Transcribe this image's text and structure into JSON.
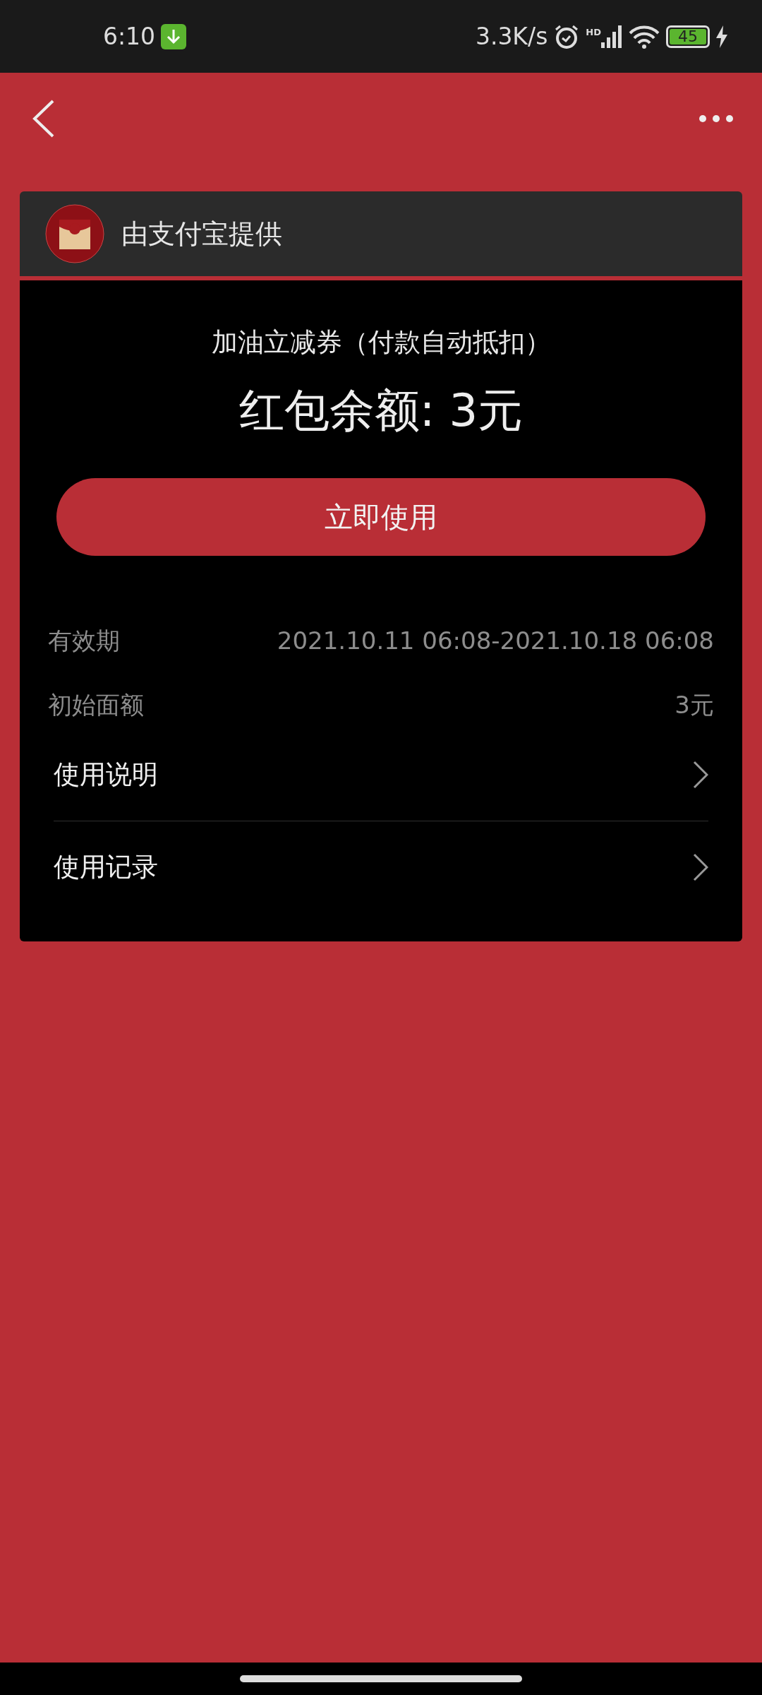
{
  "status_bar": {
    "time": "6:10",
    "speed": "3.3K/s",
    "network_badge": "HD",
    "battery": "45"
  },
  "provider": {
    "text": "由支付宝提供"
  },
  "voucher": {
    "title": "加油立减券（付款自动抵扣）",
    "balance": "红包余额: 3元",
    "button": "立即使用"
  },
  "details": [
    {
      "label": "有效期",
      "value": "2021.10.11 06:08-2021.10.18 06:08"
    },
    {
      "label": "初始面额",
      "value": "3元"
    }
  ],
  "links": [
    {
      "label": "使用说明"
    },
    {
      "label": "使用记录"
    }
  ]
}
